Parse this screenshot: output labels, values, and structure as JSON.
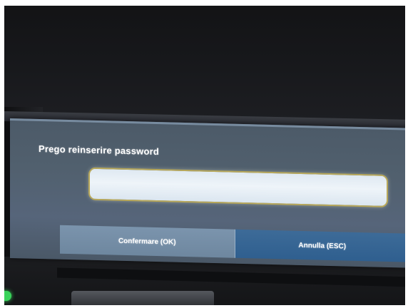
{
  "dialog": {
    "title": "Prego reinserire password",
    "password_value": "",
    "confirm_label": "Confermare (OK)",
    "cancel_label": "Annulla (ESC)"
  },
  "colors": {
    "panel": "#51606e",
    "field": "#e6eef5",
    "confirm_button": "#7b94ad",
    "cancel_button": "#2f5f8f",
    "led": "#39d35a"
  }
}
